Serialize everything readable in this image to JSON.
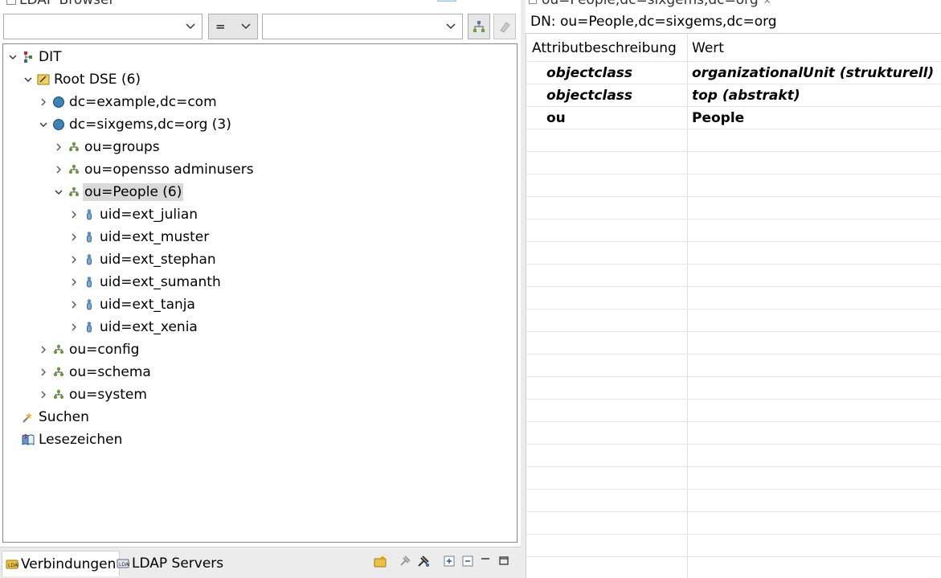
{
  "left_panel": {
    "title": "LDAP Browser",
    "toolbar": {
      "attribute_combo_value": "",
      "operator_value": "=",
      "value_combo_value": ""
    },
    "tree": [
      {
        "label": "DIT",
        "icon": "dit-icon",
        "expanded": true,
        "level": 0
      },
      {
        "label": "Root DSE (6)",
        "icon": "root-dse-icon",
        "expanded": true,
        "level": 1
      },
      {
        "label": "dc=example,dc=com",
        "icon": "globe-icon",
        "expanded": false,
        "level": 2
      },
      {
        "label": "dc=sixgems,dc=org (3)",
        "icon": "globe-icon",
        "expanded": true,
        "level": 2
      },
      {
        "label": "ou=groups",
        "icon": "org-unit-icon",
        "expanded": false,
        "level": 3
      },
      {
        "label": "ou=opensso adminusers",
        "icon": "org-unit-icon",
        "expanded": false,
        "level": 3
      },
      {
        "label": "ou=People (6)",
        "icon": "org-unit-icon",
        "expanded": true,
        "level": 3,
        "selected": true
      },
      {
        "label": "uid=ext_julian",
        "icon": "person-icon",
        "expanded": false,
        "level": 4
      },
      {
        "label": "uid=ext_muster",
        "icon": "person-icon",
        "expanded": false,
        "level": 4
      },
      {
        "label": "uid=ext_stephan",
        "icon": "person-icon",
        "expanded": false,
        "level": 4
      },
      {
        "label": "uid=ext_sumanth",
        "icon": "person-icon",
        "expanded": false,
        "level": 4
      },
      {
        "label": "uid=ext_tanja",
        "icon": "person-icon",
        "expanded": false,
        "level": 4
      },
      {
        "label": "uid=ext_xenia",
        "icon": "person-icon",
        "expanded": false,
        "level": 4
      },
      {
        "label": "ou=config",
        "icon": "org-unit-icon",
        "expanded": false,
        "level": 2
      },
      {
        "label": "ou=schema",
        "icon": "org-unit-icon",
        "expanded": false,
        "level": 2
      },
      {
        "label": "ou=system",
        "icon": "org-unit-icon",
        "expanded": false,
        "level": 2
      },
      {
        "label": "Suchen",
        "icon": "search-icon",
        "expanded": null,
        "level": 0
      },
      {
        "label": "Lesezeichen",
        "icon": "bookmark-icon",
        "expanded": null,
        "level": 0
      }
    ],
    "bottom_tabs": [
      {
        "label": "Verbindungen",
        "icon": "connections-icon",
        "active": true
      },
      {
        "label": "LDAP Servers",
        "icon": "ldap-servers-icon",
        "active": false
      }
    ]
  },
  "right_panel": {
    "tab_title": "ou=People,dc=sixgems,dc=org",
    "dn": "DN: ou=People,dc=sixgems,dc=org",
    "columns": [
      "Attributbeschreibung",
      "Wert"
    ],
    "rows": [
      {
        "attribute": "objectclass",
        "value": "organizationalUnit (strukturell)",
        "italic": true
      },
      {
        "attribute": "objectclass",
        "value": "top (abstrakt)",
        "italic": true
      },
      {
        "attribute": "ou",
        "value": "People",
        "italic": false
      }
    ]
  },
  "colors": {
    "selection": "#d9d9d9",
    "border": "#828790",
    "tab_bar": "#ececec"
  }
}
